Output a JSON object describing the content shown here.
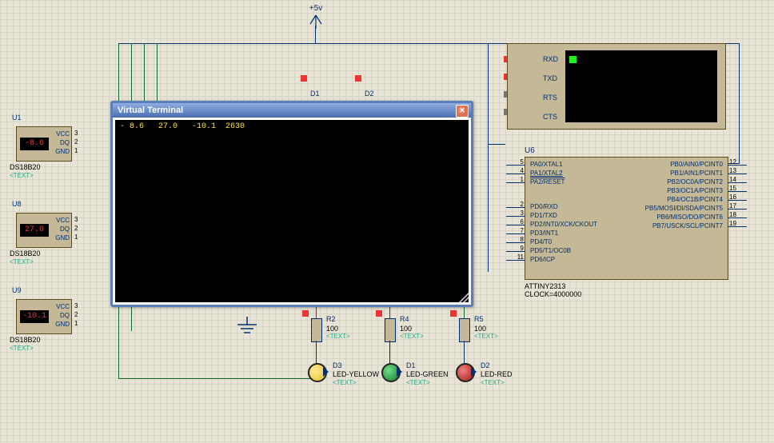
{
  "power_label": "+5v",
  "terminal": {
    "title": "Virtual Terminal",
    "content": "- 8.6   27.0   -10.1  2630"
  },
  "sensors": [
    {
      "designator": "U1",
      "part": "DS18B20",
      "value": "-8.6",
      "pins": [
        "VCC",
        "DQ",
        "GND"
      ],
      "pin_nums": [
        "3",
        "2",
        "1"
      ],
      "text_label": "<TEXT>"
    },
    {
      "designator": "U8",
      "part": "DS18B20",
      "value": "27.0",
      "pins": [
        "VCC",
        "DQ",
        "GND"
      ],
      "pin_nums": [
        "3",
        "2",
        "1"
      ],
      "text_label": "<TEXT>"
    },
    {
      "designator": "U9",
      "part": "DS18B20",
      "value": "-10.1",
      "pins": [
        "VCC",
        "DQ",
        "GND"
      ],
      "pin_nums": [
        "3",
        "2",
        "1"
      ],
      "text_label": "<TEXT>"
    }
  ],
  "vcom": {
    "pins": [
      "RXD",
      "TXD",
      "RTS",
      "CTS"
    ]
  },
  "mcu": {
    "designator": "U6",
    "part": "ATTINY2313",
    "clock_label": "CLOCK=4000000",
    "left_pins": [
      {
        "num": "5",
        "label": "PA0/XTAL1"
      },
      {
        "num": "4",
        "label": "PA1/XTAL2"
      },
      {
        "num": "1",
        "label": "PA2/RESET"
      },
      {
        "num": "2",
        "label": "PD0/RXD"
      },
      {
        "num": "3",
        "label": "PD1/TXD"
      },
      {
        "num": "6",
        "label": "PD2/INT0/XCK/CKOUT"
      },
      {
        "num": "7",
        "label": "PD3/INT1"
      },
      {
        "num": "8",
        "label": "PD4/T0"
      },
      {
        "num": "9",
        "label": "PD5/T1/OC0B"
      },
      {
        "num": "11",
        "label": "PD6/ICP"
      }
    ],
    "right_pins": [
      {
        "num": "12",
        "label": "PB0/AIN0/PCINT0"
      },
      {
        "num": "13",
        "label": "PB1/AIN1/PCINT1"
      },
      {
        "num": "14",
        "label": "PB2/OC0A/PCINT2"
      },
      {
        "num": "15",
        "label": "PB3/OC1A/PCINT3"
      },
      {
        "num": "16",
        "label": "PB4/OC1B/PCINT4"
      },
      {
        "num": "17",
        "label": "PB5/MOSI/DI/SDA/PCINT5"
      },
      {
        "num": "18",
        "label": "PB6/MISO/DO/PCINT6"
      },
      {
        "num": "19",
        "label": "PB7/USCK/SCL/PCINT7"
      }
    ]
  },
  "resistors": [
    {
      "designator": "R2",
      "value": "100",
      "text": "<TEXT>"
    },
    {
      "designator": "R4",
      "value": "100",
      "text": "<TEXT>"
    },
    {
      "designator": "R5",
      "value": "100",
      "text": "<TEXT>"
    }
  ],
  "leds": [
    {
      "designator": "D3",
      "part": "LED-YELLOW",
      "text": "<TEXT>"
    },
    {
      "designator": "D1",
      "part": "LED-GREEN",
      "text": "<TEXT>"
    },
    {
      "designator": "D2",
      "part": "LED-RED",
      "text": "<TEXT>"
    }
  ],
  "implied_labels": {
    "D1_top": "D1",
    "D2_top": "D2"
  }
}
